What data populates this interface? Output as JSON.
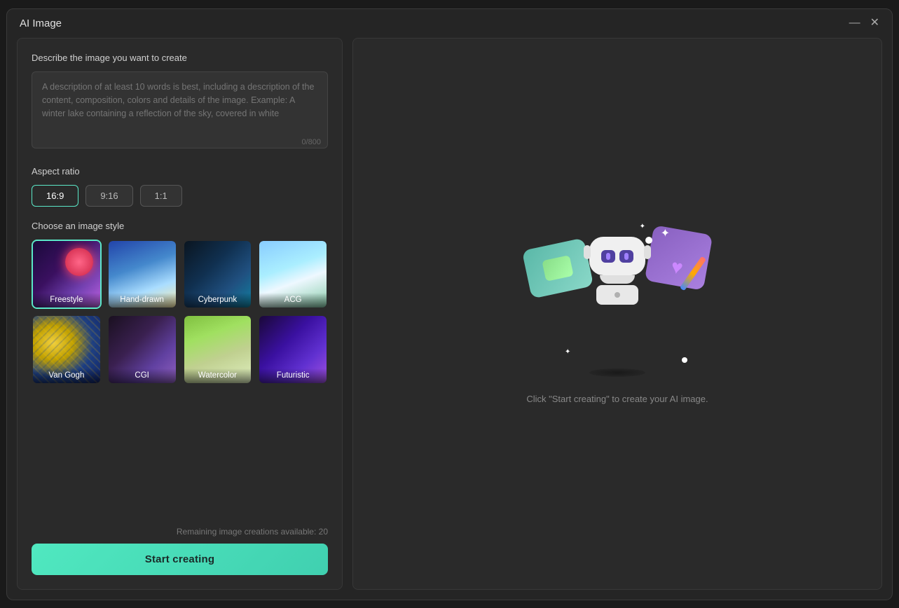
{
  "window": {
    "title": "AI Image"
  },
  "controls": {
    "minimize": "—",
    "close": "✕"
  },
  "left": {
    "describe_label": "Describe the image you want to create",
    "textarea_placeholder": "A description of at least 10 words is best, including a description of the content, composition, colors and details of the image. Example: A winter lake containing a reflection of the sky, covered in white",
    "char_count": "0/800",
    "aspect_ratio_label": "Aspect ratio",
    "aspect_buttons": [
      {
        "label": "16:9",
        "active": true
      },
      {
        "label": "9:16",
        "active": false
      },
      {
        "label": "1:1",
        "active": false
      }
    ],
    "style_label": "Choose an image style",
    "styles": [
      {
        "id": "freestyle",
        "label": "Freestyle",
        "selected": true
      },
      {
        "id": "hand-drawn",
        "label": "Hand-drawn",
        "selected": false
      },
      {
        "id": "cyberpunk",
        "label": "Cyberpunk",
        "selected": false
      },
      {
        "id": "acg",
        "label": "ACG",
        "selected": false
      },
      {
        "id": "van-gogh",
        "label": "Van Gogh",
        "selected": false
      },
      {
        "id": "cgi",
        "label": "CGI",
        "selected": false
      },
      {
        "id": "watercolor",
        "label": "Watercolor",
        "selected": false
      },
      {
        "id": "futuristic",
        "label": "Futuristic",
        "selected": false
      }
    ],
    "remaining_text": "Remaining image creations available: 20",
    "start_button": "Start creating"
  },
  "right": {
    "hint_text": "Click \"Start creating\" to create your AI image."
  }
}
